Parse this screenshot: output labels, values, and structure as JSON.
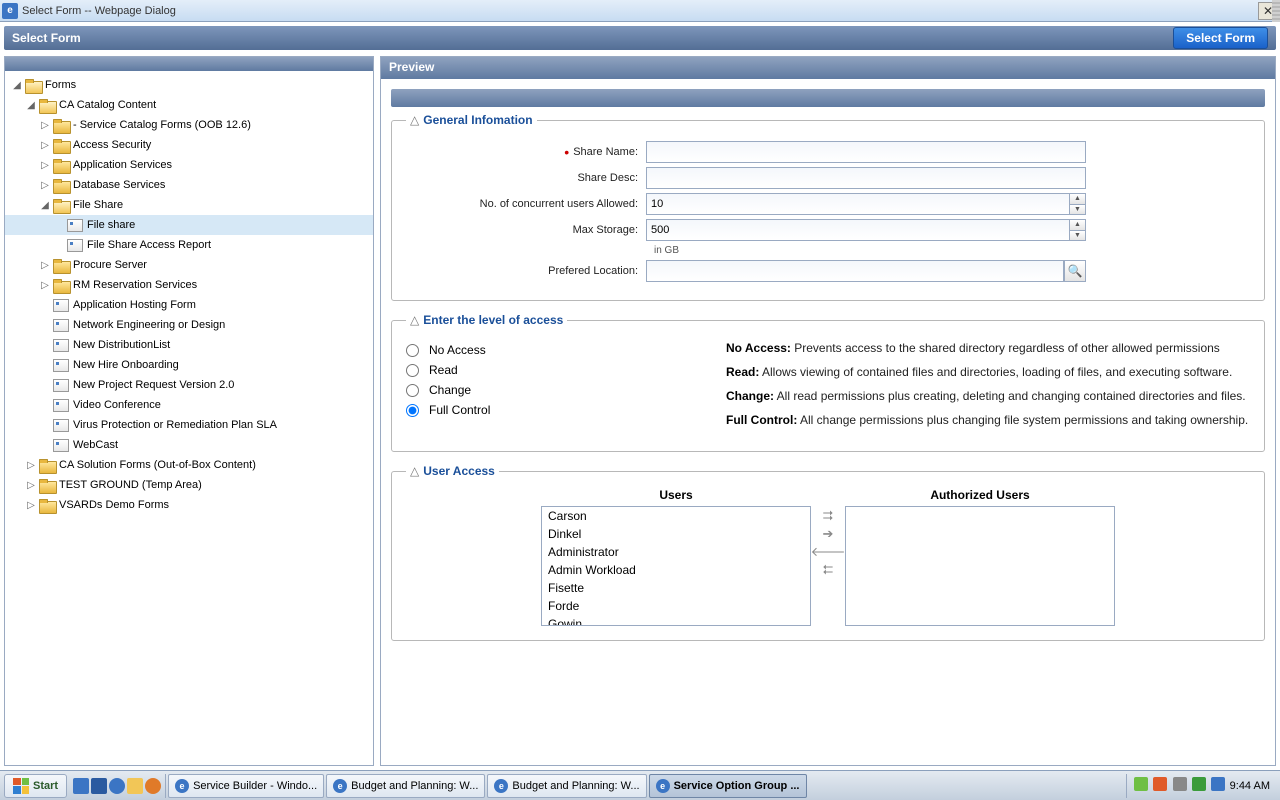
{
  "window": {
    "title": "Select Form -- Webpage Dialog"
  },
  "header": {
    "title": "Select Form",
    "button": "Select Form"
  },
  "preview": {
    "title": "Preview"
  },
  "tree": {
    "root": "Forms",
    "caCatalog": "CA Catalog Content",
    "items2": [
      "- Service Catalog Forms (OOB 12.6)",
      "Access Security",
      "Application Services",
      "Database Services"
    ],
    "fileShare": "File Share",
    "fileShareChild1": "File share",
    "fileShareChild2": "File Share Access Report",
    "items2b": [
      "Procure Server",
      "RM Reservation Services"
    ],
    "leaves2": [
      "Application Hosting Form",
      "Network Engineering or Design",
      "New DistributionList",
      "New Hire Onboarding",
      "New Project Request Version 2.0",
      "Video Conference",
      "Virus Protection or Remediation Plan SLA",
      "WebCast"
    ],
    "items1": [
      "CA Solution Forms (Out-of-Box Content)",
      "TEST GROUND (Temp Area)",
      "VSARDs Demo Forms"
    ]
  },
  "fs_general": {
    "legend": "General Infomation",
    "shareName": "Share Name:",
    "shareDesc": "Share Desc:",
    "concurrent": "No. of concurrent users Allowed:",
    "concurrentVal": "10",
    "maxStorage": "Max Storage:",
    "maxStorageVal": "500",
    "maxStorageHint": "in GB",
    "location": "Prefered Location:"
  },
  "fs_access": {
    "legend": "Enter the level of access",
    "opts": [
      "No Access",
      "Read",
      "Change",
      "Full Control"
    ],
    "desc": {
      "noaccess_b": "No Access:",
      "noaccess": " Prevents access to the shared directory regardless of other allowed permissions",
      "read_b": "Read:",
      "read": " Allows viewing of contained files and directories, loading of files, and executing software.",
      "change_b": "Change:",
      "change": " All read permissions plus creating, deleting and changing contained directories and files.",
      "full_b": "Full Control:",
      "full": " All change permissions plus changing file system permissions and taking ownership."
    }
  },
  "fs_ua": {
    "legend": "User Access",
    "usersH": "Users",
    "authH": "Authorized Users",
    "users": [
      "Carson",
      "Dinkel",
      "Administrator",
      "Admin Workload",
      "Fisette",
      "Forde",
      "Gowin"
    ]
  },
  "taskbar": {
    "start": "Start",
    "tasks": [
      "Service Builder - Windo...",
      "Budget and Planning: W...",
      "Budget and Planning: W...",
      "Service Option Group ..."
    ],
    "time": "9:44 AM"
  }
}
